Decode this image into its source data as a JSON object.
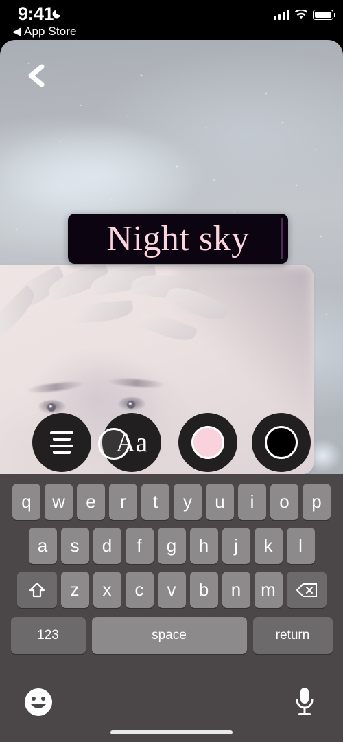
{
  "status_bar": {
    "time": "9:41",
    "dnd_icon": "moon-icon",
    "back_label": "◀ App Store",
    "signal_icon": "cellular-signal-icon",
    "wifi_icon": "wifi-icon",
    "battery_icon": "battery-full-icon"
  },
  "editor": {
    "back_button": "chevron-left-icon",
    "text_overlay": {
      "value": "Night sky",
      "text_color": "#fbd4dd",
      "background_color": "#0c0410",
      "caret_color": "#4b2a55"
    },
    "toolbar": [
      {
        "name": "text-align-button",
        "icon": "text-align-center-icon",
        "label": ""
      },
      {
        "name": "font-button",
        "icon": "font-style-icon",
        "label": "Aa"
      },
      {
        "name": "color-swatch-pink",
        "icon": "color-swatch-icon",
        "color": "#f9d2dc",
        "selected": true
      },
      {
        "name": "color-swatch-black",
        "icon": "color-swatch-icon",
        "color": "#000000",
        "selected": false
      }
    ]
  },
  "keyboard": {
    "row1": [
      "q",
      "w",
      "e",
      "r",
      "t",
      "y",
      "u",
      "i",
      "o",
      "p"
    ],
    "row2": [
      "a",
      "s",
      "d",
      "f",
      "g",
      "h",
      "j",
      "k",
      "l"
    ],
    "row3": [
      "z",
      "x",
      "c",
      "v",
      "b",
      "n",
      "m"
    ],
    "shift_icon": "shift-arrow-icon",
    "backspace_icon": "backspace-delete-icon",
    "numbers_key": "123",
    "space_key": "space",
    "return_key": "return",
    "emoji_icon": "emoji-smiley-icon",
    "dictation_icon": "microphone-icon"
  }
}
